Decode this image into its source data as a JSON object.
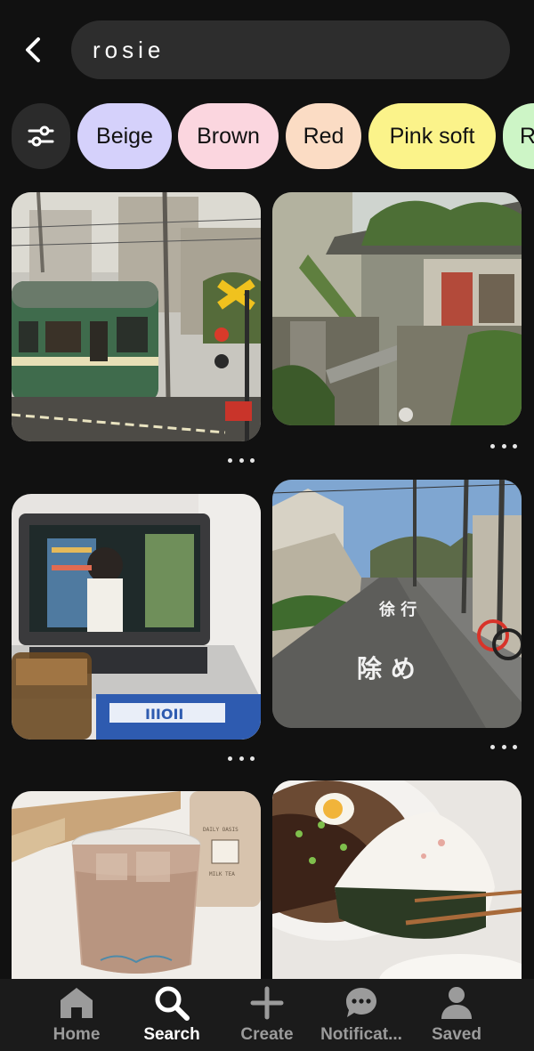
{
  "search": {
    "query": "rosie"
  },
  "chips": [
    {
      "label": "Beige",
      "color": "#d5d1fb"
    },
    {
      "label": "Brown",
      "color": "#fbd6df"
    },
    {
      "label": "Red",
      "color": "#fbdcc4"
    },
    {
      "label": "Pink soft",
      "color": "#fbf38a"
    },
    {
      "label": "R",
      "color": "#cdf5c6"
    }
  ],
  "feed": {
    "pins": [
      {
        "icon": "train-crossing-photo"
      },
      {
        "icon": "overgrown-station-photo"
      },
      {
        "icon": "laptop-anime-photo"
      },
      {
        "icon": "street-road-markings-photo",
        "road_text_1": "徐 行",
        "road_text_2": "除 め"
      },
      {
        "icon": "milk-tea-photo",
        "cup_text": "DAILY OASIS",
        "carton_text": "MILK TEA"
      },
      {
        "icon": "noodles-onigiri-photo"
      }
    ]
  },
  "nav": [
    {
      "label": "Home",
      "icon": "home-icon",
      "active": false
    },
    {
      "label": "Search",
      "icon": "search-icon",
      "active": true
    },
    {
      "label": "Create",
      "icon": "plus-icon",
      "active": false
    },
    {
      "label": "Notificat...",
      "icon": "chat-bubble-icon",
      "active": false
    },
    {
      "label": "Saved",
      "icon": "profile-icon",
      "active": false
    }
  ],
  "colors": {
    "background": "#111111",
    "search_box": "#2d2d2d",
    "nav_bg": "#1b1b1b",
    "inactive": "#9b9b9b"
  }
}
